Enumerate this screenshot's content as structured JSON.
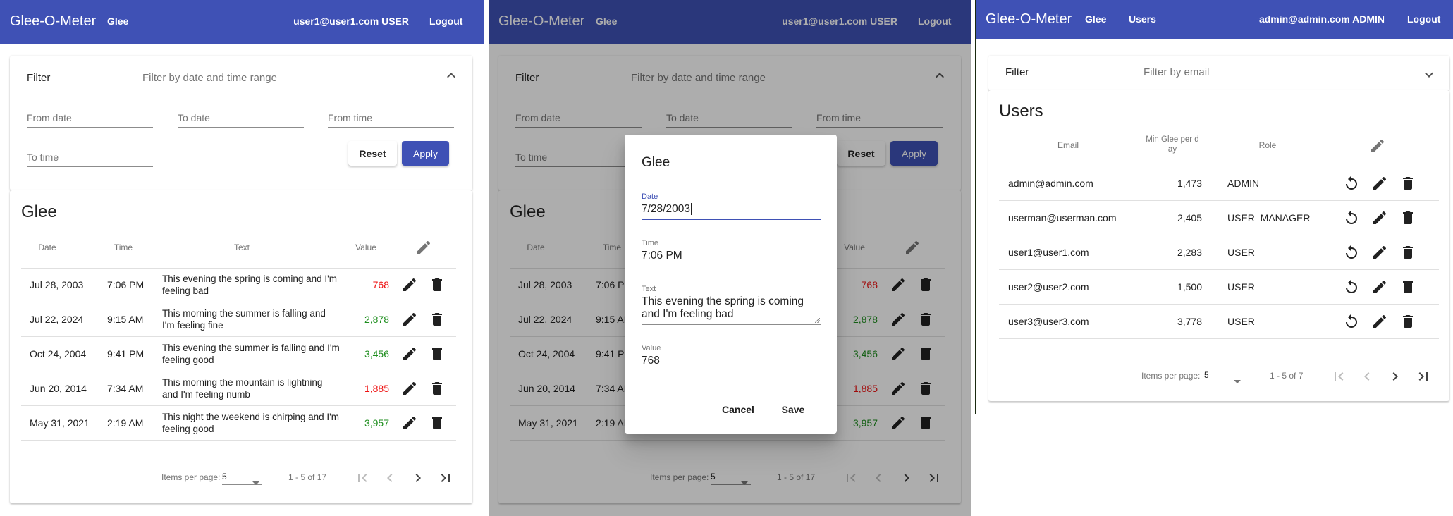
{
  "colors": {
    "primary": "#3f51b5",
    "negative": "#ee1111",
    "positive": "#1e8e1e"
  },
  "user_screen": {
    "app_title": "Glee-O-Meter",
    "nav": [
      "Glee"
    ],
    "user_label": "user1@user1.com USER",
    "logout": "Logout",
    "filter": {
      "title": "Filter",
      "description": "Filter by date and time range",
      "expanded": true,
      "fields": [
        "From date",
        "To date",
        "From time",
        "To time"
      ],
      "reset": "Reset",
      "apply": "Apply"
    },
    "table": {
      "title": "Glee",
      "headers": [
        "Date",
        "Time",
        "Text",
        "Value"
      ],
      "rows": [
        {
          "date": "Jul 28, 2003",
          "time": "7:06 PM",
          "text": "This evening the spring is coming and I'm feeling bad",
          "value": "768",
          "status": "negative"
        },
        {
          "date": "Jul 22, 2024",
          "time": "9:15 AM",
          "text": "This morning the summer is falling and I'm feeling fine",
          "value": "2,878",
          "status": "positive"
        },
        {
          "date": "Oct 24, 2004",
          "time": "9:41 PM",
          "text": "This evening the summer is falling and I'm feeling good",
          "value": "3,456",
          "status": "positive"
        },
        {
          "date": "Jun 20, 2014",
          "time": "7:34 AM",
          "text": "This morning the mountain is lightning and I'm feeling numb",
          "value": "1,885",
          "status": "negative"
        },
        {
          "date": "May 31, 2021",
          "time": "2:19 AM",
          "text": "This night the weekend is chirping and I'm feeling good",
          "value": "3,957",
          "status": "positive"
        }
      ]
    },
    "paginator": {
      "items_per_page_label": "Items per page:",
      "page_size": "5",
      "range": "1 - 5 of 17"
    }
  },
  "dialog": {
    "title": "Glee",
    "date_label": "Date",
    "date_value": "7/28/2003",
    "time_label": "Time",
    "time_value": "7:06 PM",
    "text_label": "Text",
    "text_value": "This evening the spring is coming and I'm feeling bad",
    "value_label": "Value",
    "value_value": "768",
    "cancel": "Cancel",
    "save": "Save"
  },
  "admin_screen": {
    "app_title": "Glee-O-Meter",
    "nav": [
      "Glee",
      "Users"
    ],
    "user_label": "admin@admin.com ADMIN",
    "logout": "Logout",
    "filter": {
      "title": "Filter",
      "description": "Filter by email",
      "expanded": false
    },
    "table": {
      "title": "Users",
      "headers": [
        "Email",
        "Min Glee per d ay",
        "Role"
      ],
      "rows": [
        {
          "email": "admin@admin.com",
          "min_glee": "1,473",
          "role": "ADMIN"
        },
        {
          "email": "userman@userman.com",
          "min_glee": "2,405",
          "role": "USER_MANAGER"
        },
        {
          "email": "user1@user1.com",
          "min_glee": "2,283",
          "role": "USER"
        },
        {
          "email": "user2@user2.com",
          "min_glee": "1,500",
          "role": "USER"
        },
        {
          "email": "user3@user3.com",
          "min_glee": "3,778",
          "role": "USER"
        }
      ]
    },
    "paginator": {
      "items_per_page_label": "Items per page:",
      "page_size": "5",
      "range": "1 - 5 of 7"
    }
  }
}
